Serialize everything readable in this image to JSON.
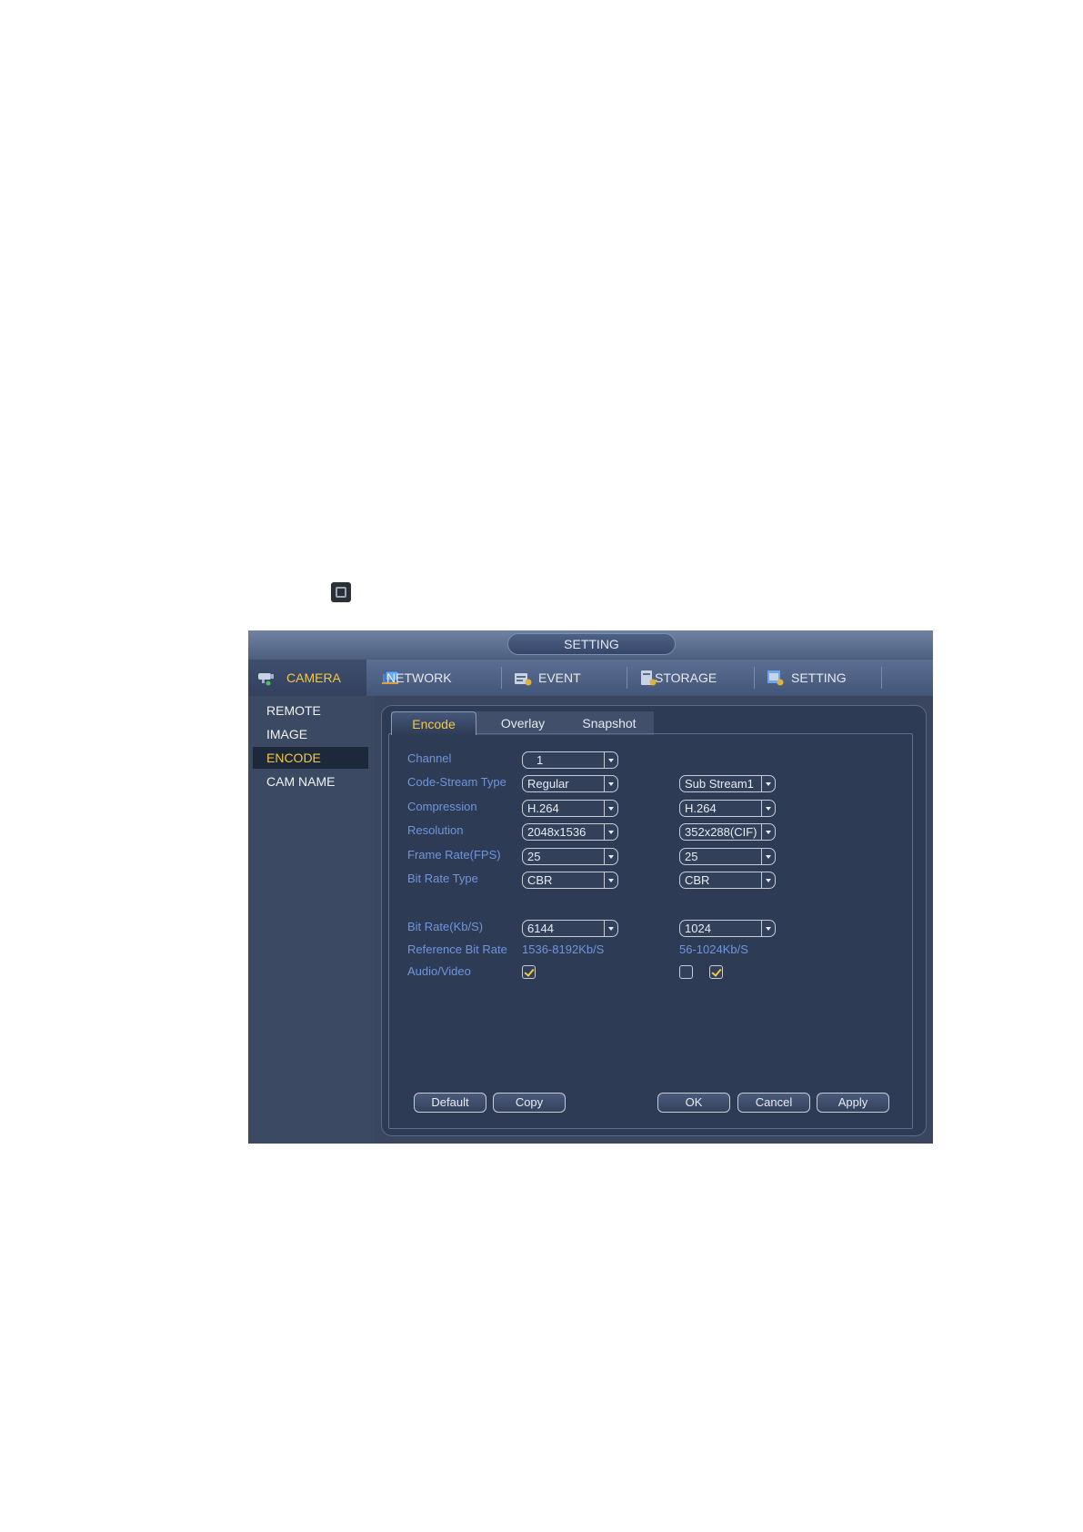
{
  "window": {
    "title": "SETTING"
  },
  "nav": [
    {
      "label": "CAMERA",
      "icon": "camera-icon"
    },
    {
      "label": "NETWORK",
      "icon": "network-icon"
    },
    {
      "label": "EVENT",
      "icon": "event-icon"
    },
    {
      "label": "STORAGE",
      "icon": "storage-icon"
    },
    {
      "label": "SETTING",
      "icon": "setting-icon"
    }
  ],
  "sidebar": {
    "items": [
      {
        "label": "REMOTE"
      },
      {
        "label": "IMAGE"
      },
      {
        "label": "ENCODE"
      },
      {
        "label": "CAM NAME"
      }
    ]
  },
  "tabs": [
    {
      "label": "Encode"
    },
    {
      "label": "Overlay"
    },
    {
      "label": "Snapshot"
    }
  ],
  "form": {
    "channel": {
      "label": "Channel",
      "main": "1"
    },
    "code_stream_type": {
      "label": "Code-Stream Type",
      "main": "Regular",
      "sub": "Sub Stream1"
    },
    "compression": {
      "label": "Compression",
      "main": "H.264",
      "sub": "H.264"
    },
    "resolution": {
      "label": "Resolution",
      "main": "2048x1536",
      "sub": "352x288(CIF)"
    },
    "frame_rate": {
      "label": "Frame Rate(FPS)",
      "main": "25",
      "sub": "25"
    },
    "bit_rate_type": {
      "label": "Bit Rate Type",
      "main": "CBR",
      "sub": "CBR"
    },
    "bit_rate": {
      "label": "Bit Rate(Kb/S)",
      "main": "6144",
      "sub": "1024"
    },
    "reference_bit_rate": {
      "label": "Reference Bit Rate",
      "main": "1536-8192Kb/S",
      "sub": "56-1024Kb/S"
    },
    "audio_video": {
      "label": "Audio/Video",
      "main_checked": true,
      "sub_first_checked": false,
      "sub_second_checked": true
    }
  },
  "buttons": {
    "default": "Default",
    "copy": "Copy",
    "ok": "OK",
    "cancel": "Cancel",
    "apply": "Apply"
  },
  "colors": {
    "accent": "#f3c844",
    "label": "#6f95dc",
    "panel": "#2e3b55"
  }
}
